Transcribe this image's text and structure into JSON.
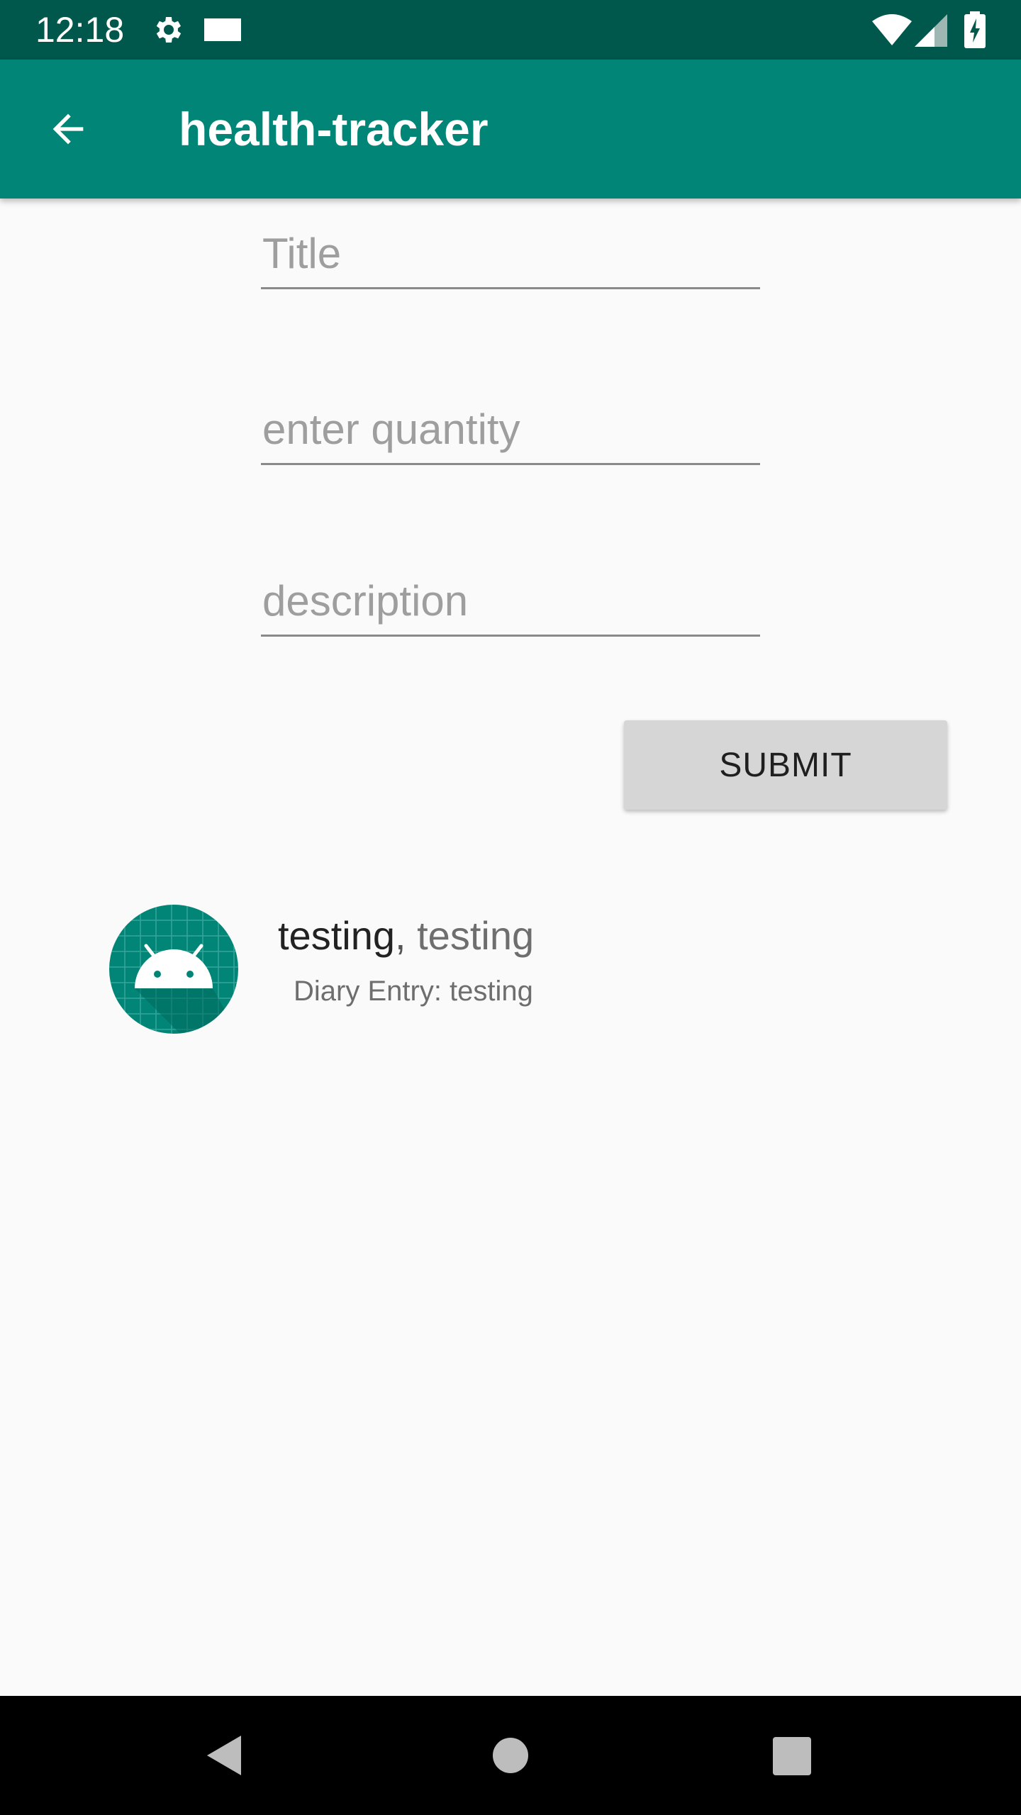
{
  "status_bar": {
    "time": "12:18",
    "icons": [
      "gear-icon",
      "rectangle-notification-icon",
      "wifi-icon",
      "signal-icon",
      "battery-charging-icon"
    ],
    "background_color": "#00574b"
  },
  "app_bar": {
    "title": "health-tracker",
    "back_icon": "arrow-back-icon",
    "background_color": "#008577"
  },
  "form": {
    "title_placeholder": "Title",
    "quantity_placeholder": "enter quantity",
    "description_placeholder": "description",
    "submit_label": "SUBMIT"
  },
  "entries": [
    {
      "title": "testing",
      "separator": ",",
      "subtitle_inline": "testing",
      "detail": "Diary Entry: testing",
      "avatar_icon": "android-icon"
    }
  ],
  "nav_bar": {
    "icons": [
      "nav-back-icon",
      "nav-home-icon",
      "nav-recents-icon"
    ]
  }
}
